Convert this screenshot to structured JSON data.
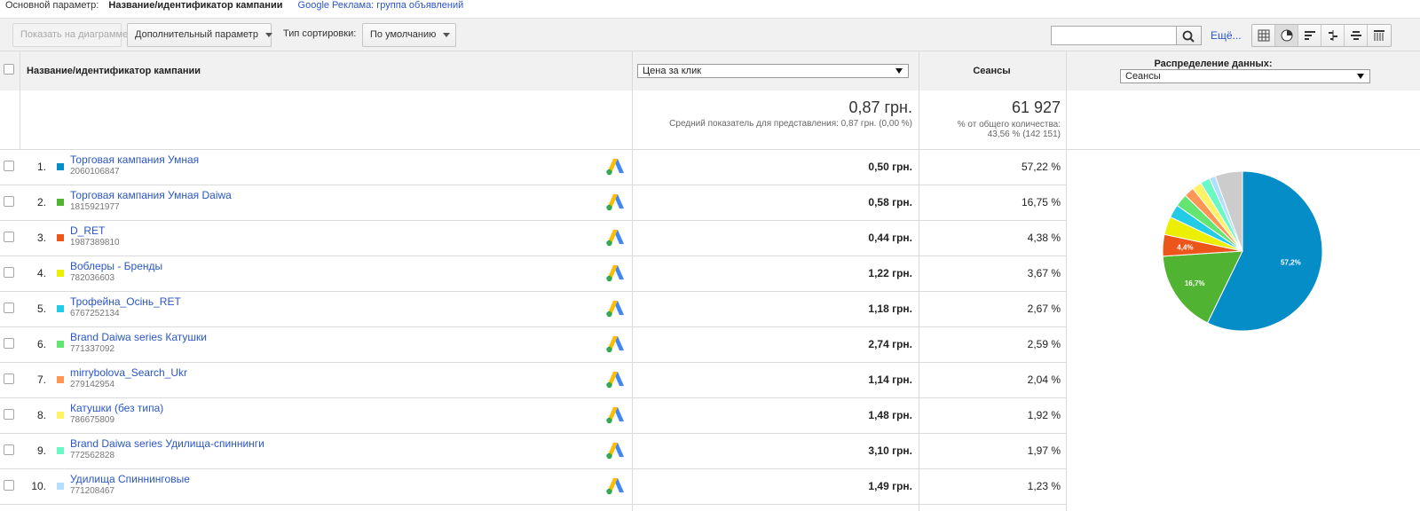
{
  "top": {
    "primary_label": "Основной параметр:",
    "primary_current": "Название/идентификатор кампании",
    "primary_link": "Google Реклама: группа объявлений"
  },
  "toolbar": {
    "plot_button": "Показать на диаграмме",
    "secondary_dim": "Дополнительный параметр",
    "sort_label": "Тип сортировки:",
    "sort_value": "По умолчанию",
    "search_value": "",
    "more_link": "Ещё..."
  },
  "header": {
    "name_col": "Название/идентификатор кампании",
    "metric_select": "Цена за клик",
    "sessions_col": "Сеансы",
    "dist_title": "Распределение данных:",
    "dist_select": "Сеансы"
  },
  "summary": {
    "cpc_value": "0,87 грн.",
    "cpc_note": "Средний показатель для представления: 0,87 грн. (0,00 %)",
    "sessions_value": "61 927",
    "sessions_note1": "% от общего количества:",
    "sessions_note2": "43,56 % (142 151)"
  },
  "rows": [
    {
      "num": "1.",
      "name": "Торговая кампания Умная",
      "id": "2060106847",
      "cpc": "0,50 грн.",
      "sessions": "57,22 %",
      "color": "#058dc7"
    },
    {
      "num": "2.",
      "name": "Торговая кампания Умная Daiwa",
      "id": "1815921977",
      "cpc": "0,58 грн.",
      "sessions": "16,75 %",
      "color": "#50b432"
    },
    {
      "num": "3.",
      "name": "D_RET",
      "id": "1987389810",
      "cpc": "0,44 грн.",
      "sessions": "4,38 %",
      "color": "#ed561b"
    },
    {
      "num": "4.",
      "name": "Воблеры - Бренды",
      "id": "782036603",
      "cpc": "1,22 грн.",
      "sessions": "3,67 %",
      "color": "#edef00"
    },
    {
      "num": "5.",
      "name": "Трофейна_Осінь_RET",
      "id": "6767252134",
      "cpc": "1,18 грн.",
      "sessions": "2,67 %",
      "color": "#24cbe5"
    },
    {
      "num": "6.",
      "name": "Brand Daiwa series Катушки",
      "id": "771337092",
      "cpc": "2,74 грн.",
      "sessions": "2,59 %",
      "color": "#64e572"
    },
    {
      "num": "7.",
      "name": "mirrybolova_Search_Ukr",
      "id": "279142954",
      "cpc": "1,14 грн.",
      "sessions": "2,04 %",
      "color": "#ff9655"
    },
    {
      "num": "8.",
      "name": "Катушки (без типа)",
      "id": "786675809",
      "cpc": "1,48 грн.",
      "sessions": "1,92 %",
      "color": "#fff263"
    },
    {
      "num": "9.",
      "name": "Brand Daiwa series Удилища-спиннинги",
      "id": "772562828",
      "cpc": "3,10 грн.",
      "sessions": "1,97 %",
      "color": "#6af9c4"
    },
    {
      "num": "10.",
      "name": "Удилища Спиннинговые",
      "id": "771208467",
      "cpc": "1,49 грн.",
      "sessions": "1,23 %",
      "color": "#b2deff"
    }
  ],
  "chart_data": {
    "type": "pie",
    "categories": [
      "Торговая кампания Умная",
      "Торговая кампания Умная Daiwa",
      "D_RET",
      "Воблеры - Бренды",
      "Трофейна_Осінь_RET",
      "Brand Daiwa series Катушки",
      "mirrybolova_Search_Ukr",
      "Катушки (без типа)",
      "Brand Daiwa series Удилища-спиннинги",
      "Удилища Спиннинговые",
      ""
    ],
    "values": [
      57.22,
      16.75,
      4.38,
      3.67,
      2.67,
      2.59,
      2.04,
      1.92,
      1.97,
      1.23,
      5.56
    ],
    "colors": [
      "#058dc7",
      "#50b432",
      "#ed561b",
      "#edef00",
      "#24cbe5",
      "#64e572",
      "#ff9655",
      "#fff263",
      "#6af9c4",
      "#b2deff",
      "#cccccc"
    ],
    "slice_labels": [
      "57,2%",
      "16,7%",
      "4,4%"
    ]
  }
}
